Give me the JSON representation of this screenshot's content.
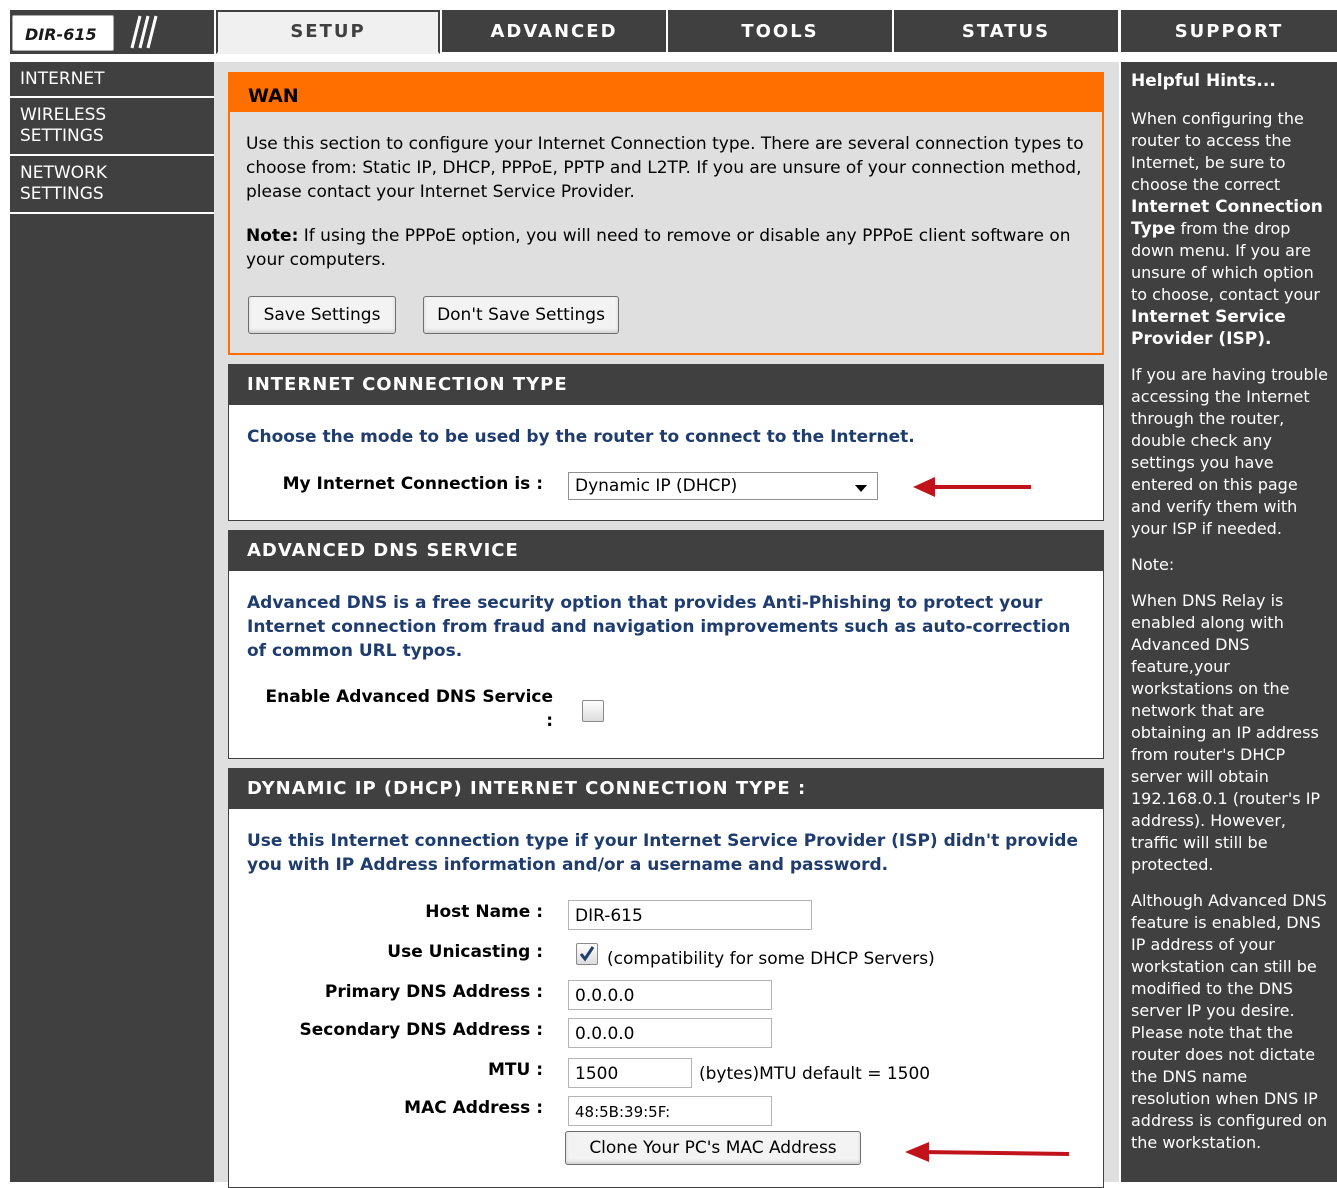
{
  "logo": {
    "model": "DIR-615"
  },
  "nav": {
    "tabs": [
      {
        "label": "SETUP",
        "active": true
      },
      {
        "label": "ADVANCED",
        "active": false
      },
      {
        "label": "TOOLS",
        "active": false
      },
      {
        "label": "STATUS",
        "active": false
      },
      {
        "label": "SUPPORT",
        "active": false
      }
    ]
  },
  "sidebar": {
    "items": [
      {
        "label": "INTERNET"
      },
      {
        "label": "WIRELESS SETTINGS"
      },
      {
        "label": "NETWORK SETTINGS"
      }
    ]
  },
  "wan": {
    "title": "WAN",
    "intro": "Use this section to configure your Internet Connection type. There are several connection types to choose from: Static IP, DHCP, PPPoE, PPTP and L2TP. If you are unsure of your connection method, please contact your Internet Service Provider.",
    "note_label": "Note:",
    "note_text": " If using the PPPoE option, you will need to remove or disable any PPPoE client software on your computers.",
    "save_button": "Save Settings",
    "dont_save_button": "Don't Save Settings"
  },
  "connection_type": {
    "title": "INTERNET CONNECTION TYPE",
    "description": "Choose the mode to be used by the router to connect to the Internet.",
    "label": "My Internet Connection is :",
    "selected": "Dynamic IP (DHCP)"
  },
  "dns_service": {
    "title": "ADVANCED DNS SERVICE",
    "description": "Advanced DNS is a free security option that provides Anti-Phishing to protect your Internet connection from fraud and navigation improvements such as auto-correction of common URL typos.",
    "enable_label": "Enable Advanced DNS Service",
    "enable_colon": ":",
    "enabled": false
  },
  "dhcp": {
    "title": "DYNAMIC IP (DHCP) INTERNET CONNECTION TYPE :",
    "description": "Use this Internet connection type if your Internet Service Provider (ISP) didn't provide you with IP Address information and/or a username and password.",
    "host_name_label": "Host Name :",
    "host_name": "DIR-615",
    "unicast_label": "Use Unicasting :",
    "unicast_checked": true,
    "unicast_note": "(compatibility for some DHCP Servers)",
    "primary_dns_label": "Primary DNS Address :",
    "primary_dns": "0.0.0.0",
    "secondary_dns_label": "Secondary DNS Address :",
    "secondary_dns": "0.0.0.0",
    "mtu_label": "MTU :",
    "mtu": "1500",
    "mtu_note": "(bytes)MTU default = 1500",
    "mac_label": "MAC Address :",
    "mac": "48:5B:39:5F:",
    "clone_button": "Clone Your PC's MAC Address"
  },
  "hints": {
    "title": "Helpful Hints...",
    "p1_a": "When configuring the router to access the Internet, be sure to choose the correct ",
    "p1_b": "Internet Connection Type",
    "p1_c": " from the drop down menu. If you are unsure of which option to choose, contact your ",
    "p1_d": "Internet Service Provider (ISP).",
    "p2": "If you are having trouble accessing the Internet through the router, double check any settings you have entered on this page and verify them with your ISP if needed.",
    "p3": "Note:",
    "p4": "When DNS Relay is enabled along with Advanced DNS feature,your workstations on the network that are obtaining an IP address from router's DHCP server will obtain 192.168.0.1 (router's IP address). However, traffic will still be protected.",
    "p5": "Although Advanced DNS feature is enabled, DNS IP address of your workstation can still be modified to the DNS server IP you desire. Please note that the router does not dictate the DNS name resolution when DNS IP address is configured on the workstation."
  },
  "colors": {
    "dark": "#404040",
    "accent_orange": "#ff6f00",
    "panel_gray": "#dfdfdf",
    "link_blue": "#1f3c6e",
    "arrow_red": "#c0141a"
  }
}
